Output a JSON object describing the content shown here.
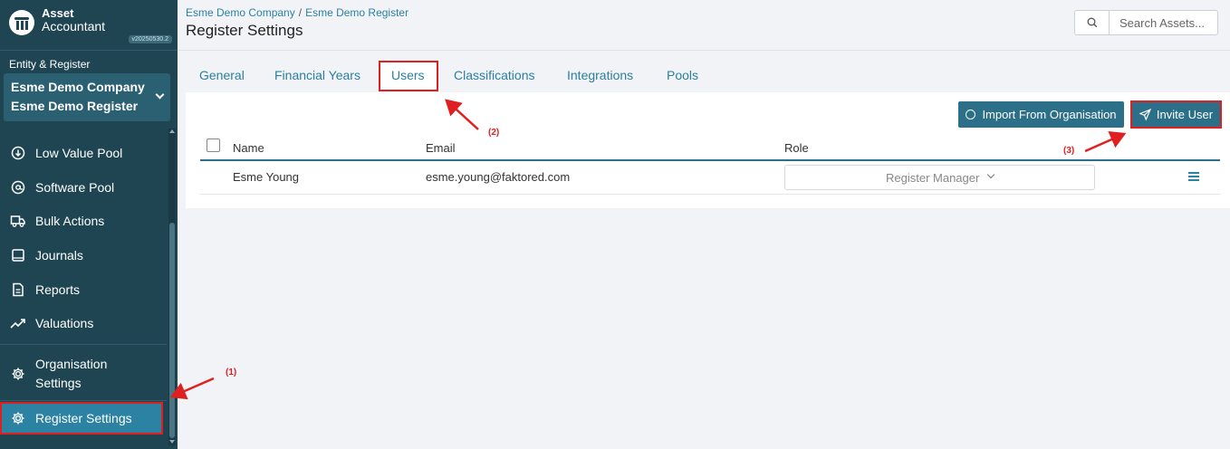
{
  "app": {
    "title": "Asset",
    "subtitle": "Accountant",
    "version": "v20250530.2"
  },
  "entity": {
    "label": "Entity & Register",
    "company": "Esme Demo Company",
    "register": "Esme Demo Register"
  },
  "sidebar": {
    "items": [
      {
        "label": "Low Value Pool",
        "icon": "circle-arrow-down-icon"
      },
      {
        "label": "Software Pool",
        "icon": "circle-at-icon"
      },
      {
        "label": "Bulk Actions",
        "icon": "truck-icon"
      },
      {
        "label": "Journals",
        "icon": "square-icon"
      },
      {
        "label": "Reports",
        "icon": "document-icon"
      },
      {
        "label": "Valuations",
        "icon": "trend-up-icon"
      },
      {
        "label": "Organisation",
        "label2": "Settings",
        "icon": "gear-icon"
      },
      {
        "label": "Register Settings",
        "icon": "gear-icon",
        "active": true
      }
    ]
  },
  "header": {
    "breadcrumb": [
      "Esme Demo Company",
      "/",
      "Esme Demo Register"
    ],
    "title": "Register Settings",
    "search": {
      "placeholder": "Search Assets..."
    }
  },
  "tabs": [
    "General",
    "Financial Years",
    "Users",
    "Classifications",
    "Integrations",
    "Pools"
  ],
  "active_tab": "Users",
  "actions": {
    "import_label": "Import From Organisation",
    "invite_label": "Invite User"
  },
  "table": {
    "headers": [
      "Name",
      "Email",
      "Role"
    ],
    "rows": [
      {
        "name": "Esme Young",
        "email": "esme.young@faktored.com",
        "role": "Register Manager"
      }
    ]
  },
  "annotations": [
    "(1)",
    "(2)",
    "(3)"
  ],
  "colors": {
    "sidebar": "#1f4553",
    "accent": "#2b82a2",
    "button": "#2b6f88",
    "highlight": "#e02020"
  }
}
